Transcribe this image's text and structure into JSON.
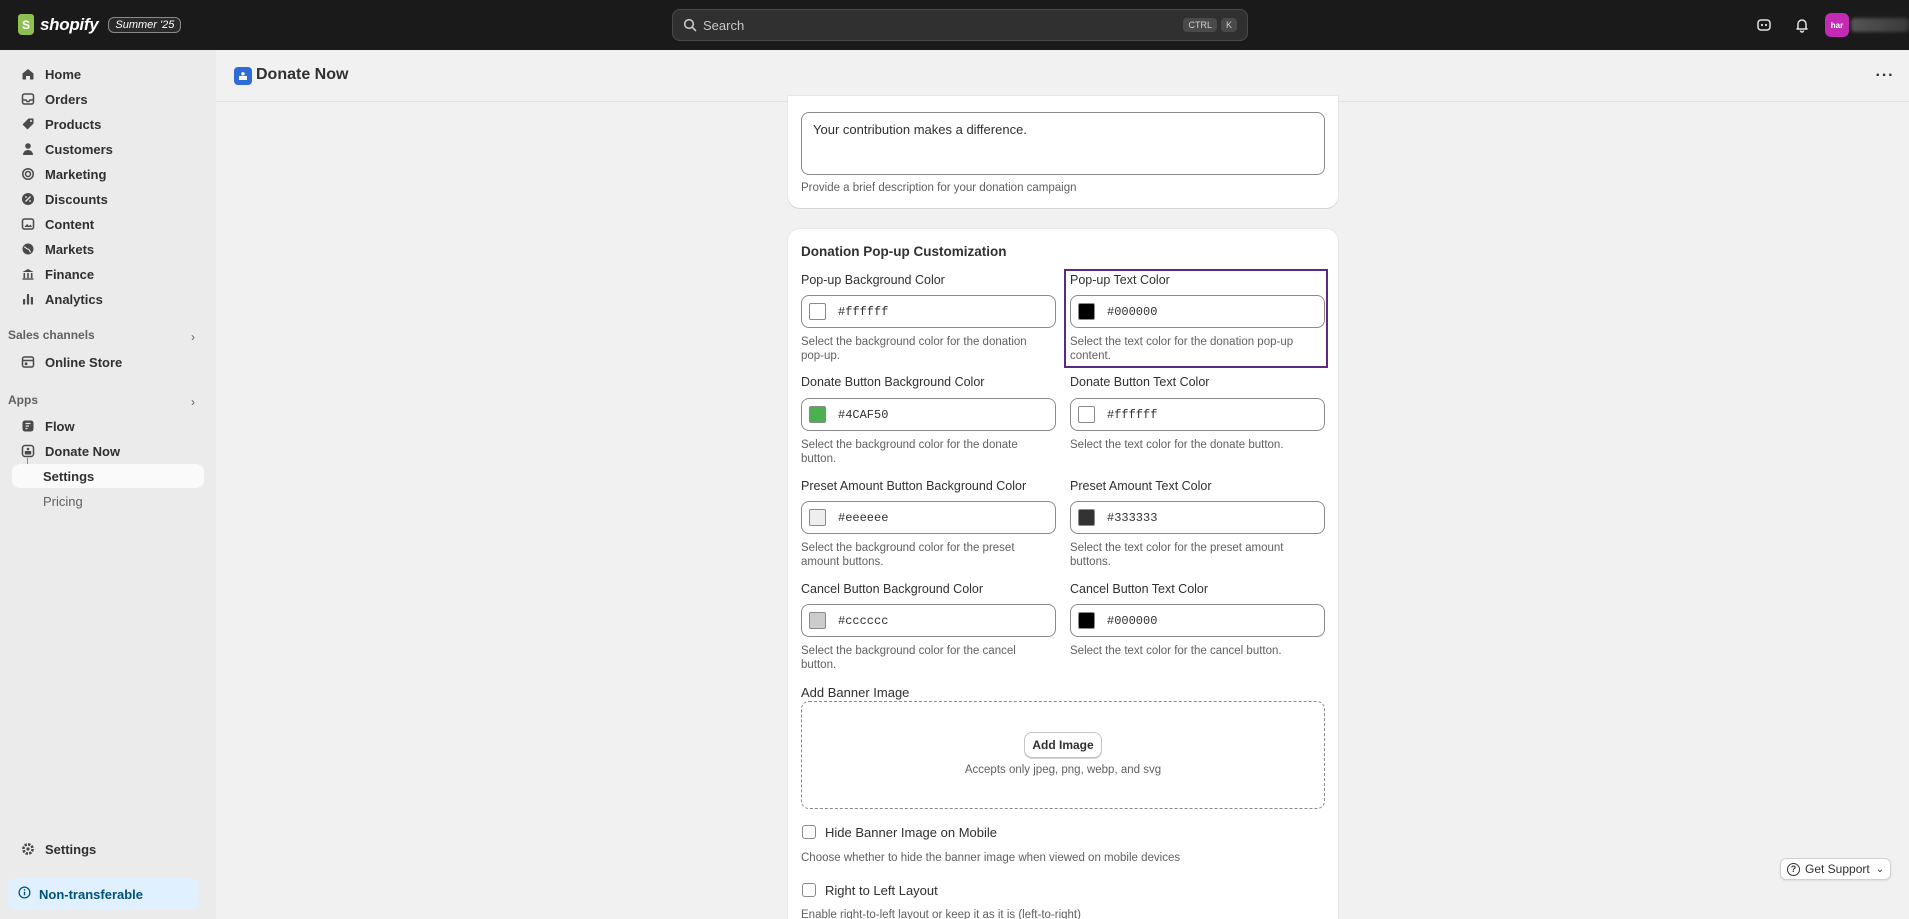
{
  "topbar": {
    "logo_text": "shopify",
    "edition_badge": "Summer '25",
    "search_placeholder": "Search",
    "shortcut_keys": [
      "CTRL",
      "K"
    ],
    "avatar_initials": "har"
  },
  "sidebar": {
    "items": [
      {
        "label": "Home",
        "icon": "home-icon"
      },
      {
        "label": "Orders",
        "icon": "orders-icon"
      },
      {
        "label": "Products",
        "icon": "tag-icon"
      },
      {
        "label": "Customers",
        "icon": "person-icon"
      },
      {
        "label": "Marketing",
        "icon": "target-icon"
      },
      {
        "label": "Discounts",
        "icon": "discount-icon"
      },
      {
        "label": "Content",
        "icon": "content-icon"
      },
      {
        "label": "Markets",
        "icon": "globe-icon"
      },
      {
        "label": "Finance",
        "icon": "bank-icon"
      },
      {
        "label": "Analytics",
        "icon": "chart-icon"
      }
    ],
    "sales_channels_label": "Sales channels",
    "online_store_label": "Online Store",
    "apps_label": "Apps",
    "flow_label": "Flow",
    "donate_now_label": "Donate Now",
    "settings_sub_label": "Settings",
    "pricing_sub_label": "Pricing",
    "settings_label": "Settings",
    "non_transferable_label": "Non-transferable"
  },
  "header": {
    "title": "Donate Now"
  },
  "description": {
    "value": "Your contribution makes a difference.",
    "help": "Provide a brief description for your donation campaign"
  },
  "popup": {
    "title": "Donation Pop-up Customization",
    "fields": [
      {
        "label": "Pop-up Background Color",
        "value": "#ffffff",
        "color": "#ffffff",
        "help": "Select the background color for the donation pop-up."
      },
      {
        "label": "Pop-up Text Color",
        "value": "#000000",
        "color": "#000000",
        "help": "Select the text color for the donation pop-up content."
      },
      {
        "label": "Donate Button Background Color",
        "value": "#4CAF50",
        "color": "#4CAF50",
        "help": "Select the background color for the donate button."
      },
      {
        "label": "Donate Button Text Color",
        "value": "#ffffff",
        "color": "#ffffff",
        "help": "Select the text color for the donate button."
      },
      {
        "label": "Preset Amount Button Background Color",
        "value": "#eeeeee",
        "color": "#eeeeee",
        "help": "Select the background color for the preset amount buttons."
      },
      {
        "label": "Preset Amount Text Color",
        "value": "#333333",
        "color": "#333333",
        "help": "Select the text color for the preset amount buttons."
      },
      {
        "label": "Cancel Button Background Color",
        "value": "#cccccc",
        "color": "#cccccc",
        "help": "Select the background color for the cancel button."
      },
      {
        "label": "Cancel Button Text Color",
        "value": "#000000",
        "color": "#000000",
        "help": "Select the text color for the cancel button."
      }
    ],
    "banner_label": "Add Banner Image",
    "add_image_button": "Add Image",
    "accepts_text": "Accepts only jpeg, png, webp, and svg",
    "hide_banner_label": "Hide Banner Image on Mobile",
    "hide_banner_help": "Choose whether to hide the banner image when viewed on mobile devices",
    "rtl_label": "Right to Left Layout",
    "rtl_help": "Enable right-to-left layout or keep it as it is (left-to-right)"
  },
  "support": {
    "label": "Get Support"
  },
  "colors": {
    "topbar": "#1a1a1a",
    "sidebar": "#ebebeb",
    "highlight_border": "#5c2a7f",
    "accent_green": "#4CAF50"
  }
}
